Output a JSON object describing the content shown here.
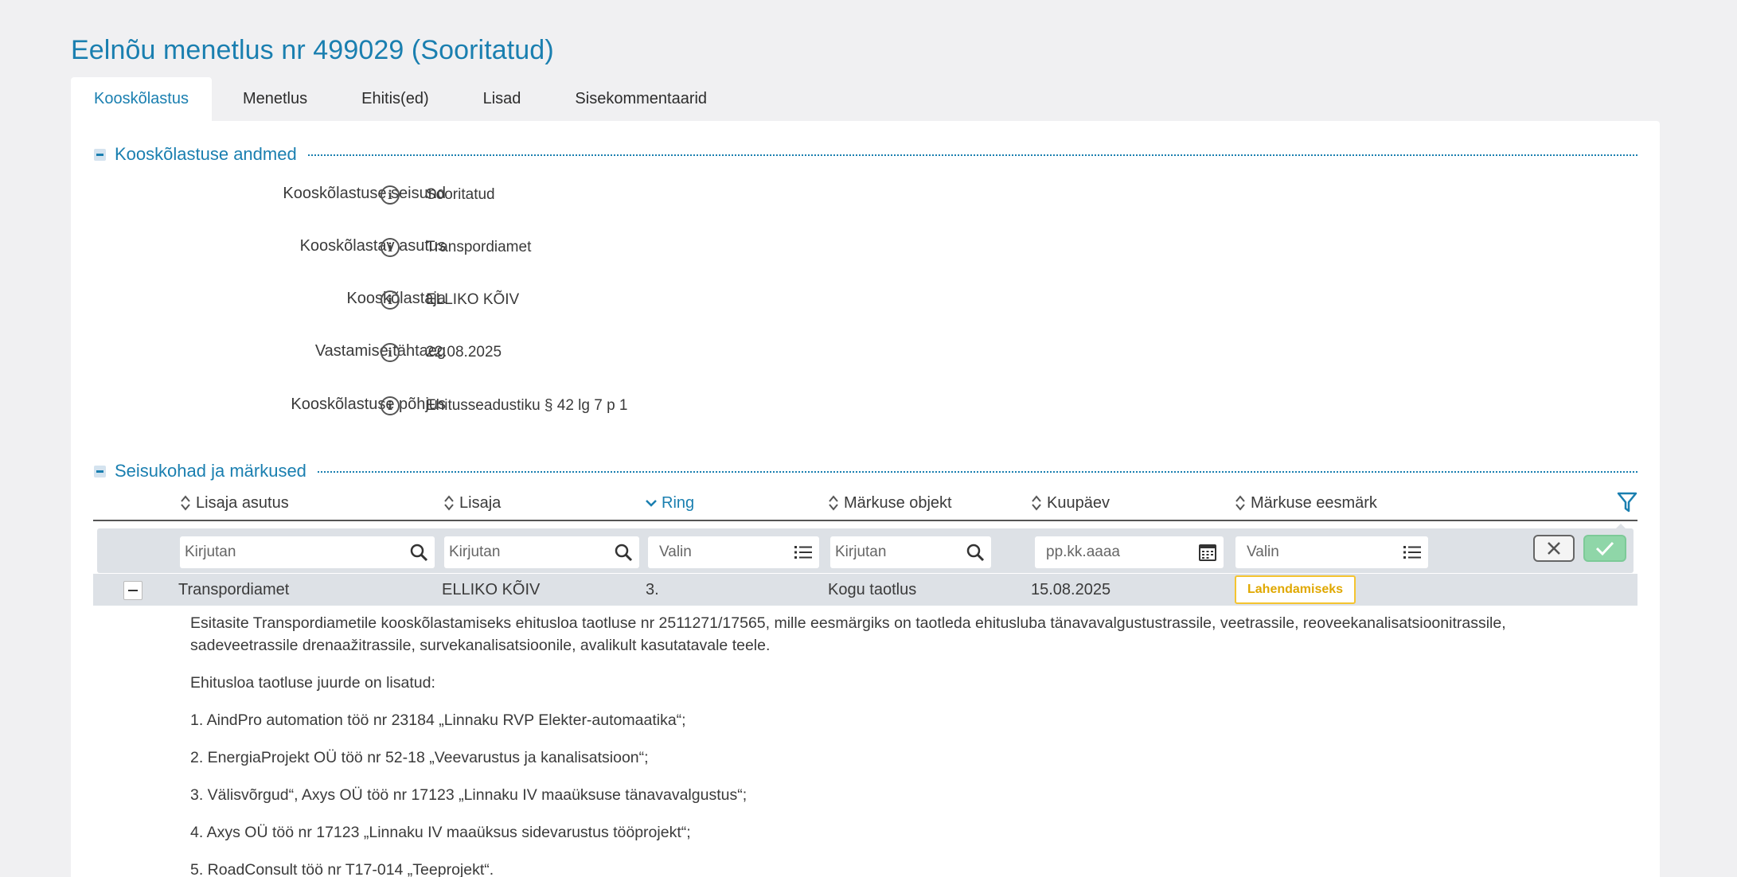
{
  "page": {
    "title": "Eelnõu menetlus nr 499029 (Sooritatud)"
  },
  "tabs": [
    {
      "label": "Kooskõlastus"
    },
    {
      "label": "Menetlus"
    },
    {
      "label": "Ehitis(ed)"
    },
    {
      "label": "Lisad"
    },
    {
      "label": "Sisekommentaarid"
    }
  ],
  "section1": {
    "title": "Kooskõlastuse andmed",
    "fields": [
      {
        "label": "Kooskõlastuse seisund",
        "value": "Sooritatud"
      },
      {
        "label": "Kooskõlastav asutus",
        "value": "Transpordiamet"
      },
      {
        "label": "Kooskõlastaja",
        "value": "ELLIKO KÕIV"
      },
      {
        "label": "Vastamise tähtaeg",
        "value": "22.08.2025"
      },
      {
        "label": "Kooskõlastuse põhjus",
        "value": "Ehitusseadustiku § 42 lg 7 p 1"
      }
    ]
  },
  "section2": {
    "title": "Seisukohad ja märkused",
    "columns": [
      {
        "label": "Lisaja asutus"
      },
      {
        "label": "Lisaja"
      },
      {
        "label": "Ring"
      },
      {
        "label": "Märkuse objekt"
      },
      {
        "label": "Kuupäev"
      },
      {
        "label": "Märkuse eesmärk"
      }
    ],
    "filters": [
      {
        "placeholder": "Kirjutan"
      },
      {
        "placeholder": "Kirjutan"
      },
      {
        "placeholder": "Valin"
      },
      {
        "placeholder": "Kirjutan"
      },
      {
        "placeholder": "pp.kk.aaaa"
      },
      {
        "placeholder": "Valin"
      }
    ],
    "row": {
      "asutus": "Transpordiamet",
      "lisaja": "ELLIKO KÕIV",
      "ring": "3.",
      "objekt": "Kogu taotlus",
      "kuupaev": "15.08.2025",
      "eesmark": "Lahendamiseks"
    },
    "detail": [
      "Esitasite Transpordiametile kooskõlastamiseks ehitusloa taotluse nr 2511271/17565, mille eesmärgiks on taotleda ehitusluba tänavavalgustustrassile, veetrassile, reoveekanalisatsioonitrassile, sadeveetrassile drenaažitrassile, survekanalisatsioonile, avalikult kasutatavale teele.",
      "Ehitusloa taotluse juurde on lisatud:",
      "1. AindPro automation töö nr 23184 „Linnaku RVP Elekter-automaatika“;",
      "2.  EnergiaProjekt OÜ töö nr 52-18 „Veevarustus ja kanalisatsioon“;",
      "3. Välisvõrgud“, Axys OÜ töö nr 17123 „Linnaku IV maaüksuse tänavavalgustus“;",
      "4. Axys OÜ töö nr 17123 „Linnaku IV maaüksus sidevarustus tööprojekt“;",
      "5. RoadConsult töö nr T17-014 „Teeprojekt“."
    ]
  },
  "colors": {
    "accent": "#1a7fb0",
    "badge": "#f4c430",
    "ok": "#8fd6a8"
  },
  "icons": {
    "info": "info-circle-icon",
    "sort": "sort-icon",
    "filter": "filter-funnel-icon",
    "search": "search-icon",
    "list": "list-icon",
    "calendar": "calendar-icon",
    "close": "close-icon",
    "check": "check-icon"
  }
}
